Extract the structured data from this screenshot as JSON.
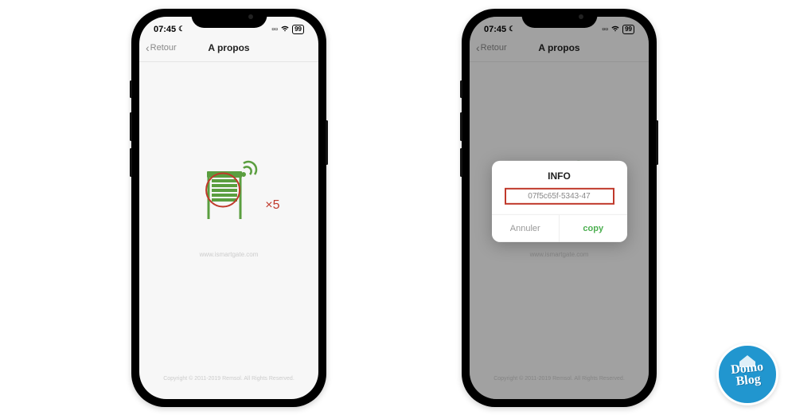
{
  "status": {
    "time": "07:45",
    "battery": "99"
  },
  "nav": {
    "back": "Retour",
    "title": "A propos"
  },
  "content": {
    "multiplier": "×5",
    "subtext": "www.ismartgate.com",
    "footer": "Copyright © 2011-2019 Remsol. All Rights Reserved."
  },
  "modal": {
    "title": "INFO",
    "value": "07f5c65f-5343-47",
    "cancel": "Annuler",
    "copy": "copy"
  },
  "logo": {
    "line1": "Domo",
    "line2": "Blog"
  }
}
